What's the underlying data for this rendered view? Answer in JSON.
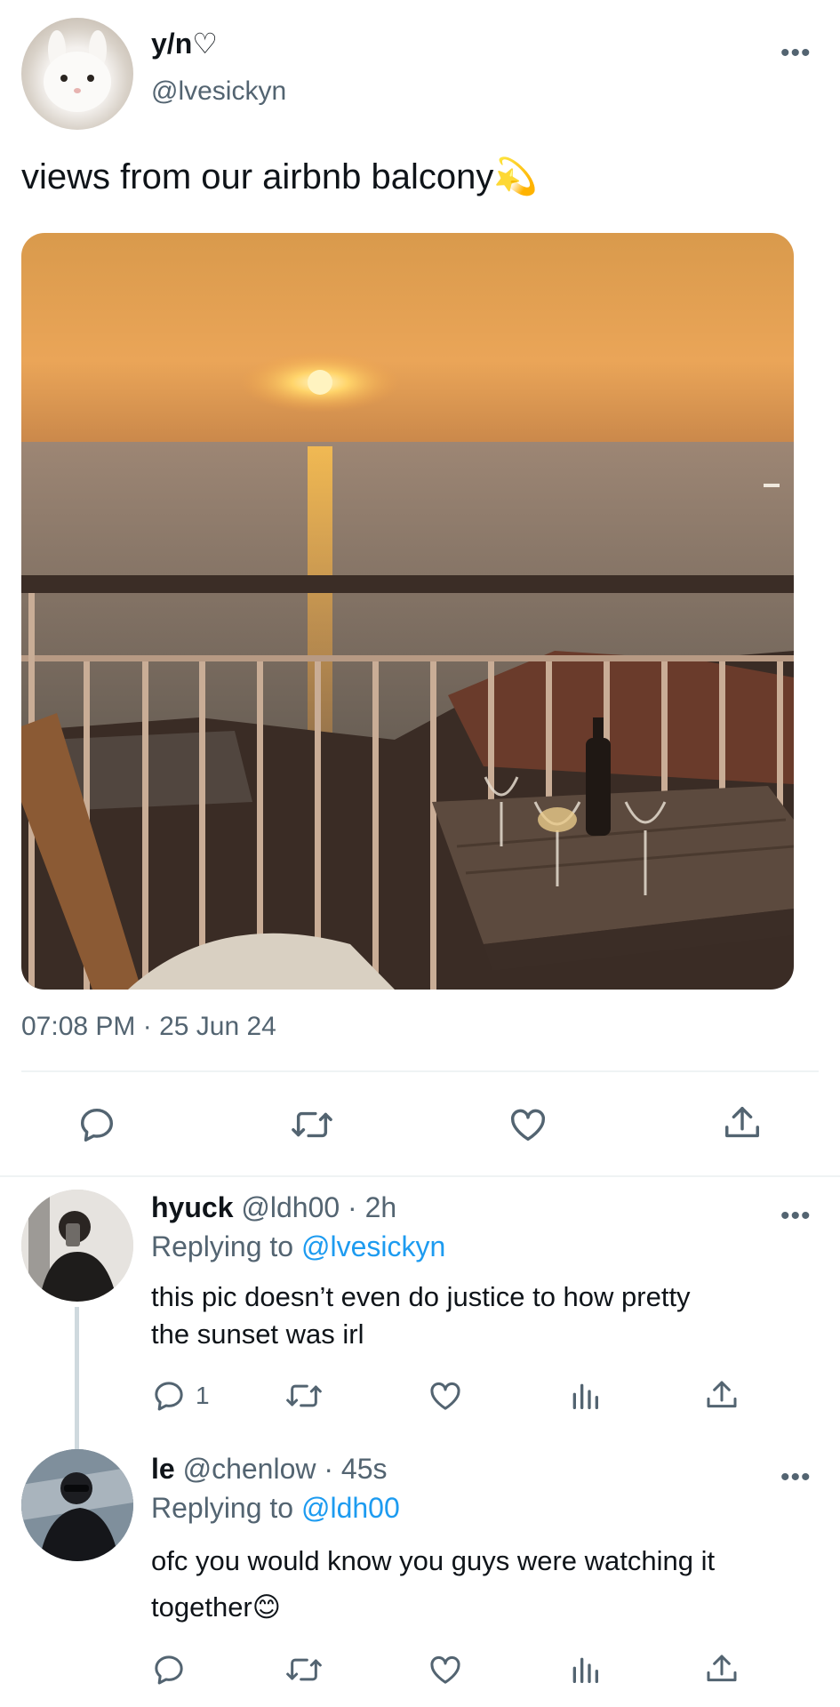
{
  "tweet": {
    "display_name": "y/n♡",
    "handle": "@lvesickyn",
    "text": "views from our airbnb balcony💫",
    "timestamp": "07:08 PM · 25 Jun 24",
    "actions": [
      "reply-icon",
      "retweet-icon",
      "like-icon",
      "share-icon"
    ]
  },
  "replies": [
    {
      "display_name": "hyuck",
      "handle_time": "@ldh00 · 2h",
      "replying_label": "Replying to",
      "replying_handle": "@lvesickyn",
      "text_line1": "this pic doesn’t even do justice to how pretty",
      "text_line2": "the sunset was irl",
      "reply_count": "1"
    },
    {
      "display_name": "le",
      "handle_time": "@chenlow · 45s",
      "replying_label": "Replying to",
      "replying_handle": "@ldh00",
      "text_line1": "ofc you would know you guys were watching it",
      "text_line2": "together😊"
    }
  ],
  "colors": {
    "text": "#0f1419",
    "secondary": "#536471",
    "link": "#1d9bf0",
    "divider": "#eff3f4"
  }
}
